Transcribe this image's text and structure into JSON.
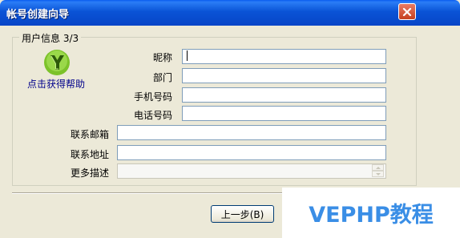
{
  "window": {
    "title": "帐号创建向导"
  },
  "group": {
    "legend": "用户信息 3/3"
  },
  "help": {
    "link": "点击获得帮助"
  },
  "fields": {
    "nickname": {
      "label": "昵称",
      "value": ""
    },
    "department": {
      "label": "部门",
      "value": ""
    },
    "mobile": {
      "label": "手机号码",
      "value": ""
    },
    "phone": {
      "label": "电话号码",
      "value": ""
    },
    "email": {
      "label": "联系邮箱",
      "value": ""
    },
    "address": {
      "label": "联系地址",
      "value": ""
    },
    "description": {
      "label": "更多描述",
      "value": ""
    }
  },
  "buttons": {
    "prev": "上一步(B)"
  },
  "watermark": {
    "text": "VEPHP教程"
  },
  "icons": {
    "close": "close-icon",
    "logo": "app-logo-icon",
    "spin": "spin-arrows-icon"
  },
  "colors": {
    "titlebar": "#0a53d6",
    "close": "#c6401f",
    "dialog": "#ece9d8",
    "link": "#00008b",
    "watermark": "#3a8ee6"
  }
}
